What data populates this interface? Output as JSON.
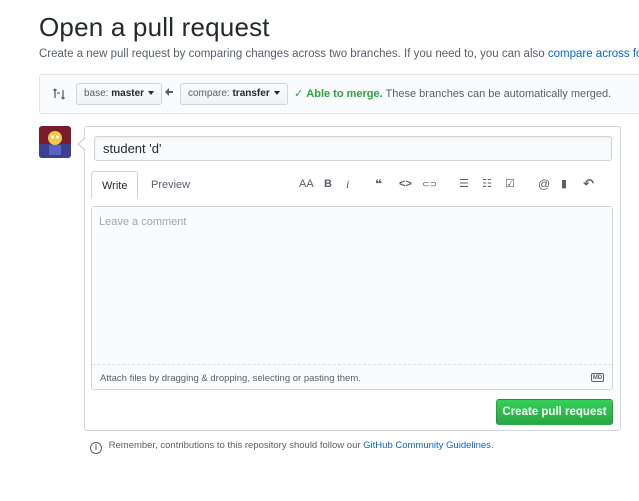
{
  "page": {
    "title": "Open a pull request",
    "subtitle_text": "Create a new pull request by comparing changes across two branches. If you need to, you can also",
    "subtitle_link": "compare across forks",
    "subtitle_end": "."
  },
  "range": {
    "base_prefix": "base:",
    "base_branch": "master",
    "compare_prefix": "compare:",
    "compare_branch": "transfer",
    "merge_status": "Able to merge.",
    "merge_detail": "These branches can be automatically merged."
  },
  "form": {
    "title_value": "student 'd'",
    "tabs": [
      {
        "label": "Write"
      },
      {
        "label": "Preview"
      }
    ],
    "toolbar": {
      "heading": "AA",
      "bold": "B",
      "italic": "i",
      "quote": "❝",
      "code": "<>",
      "link": "⊂⊃",
      "unordered_list": "☰",
      "ordered_list": "☷",
      "task_list": "☑",
      "mention": "@",
      "reference": "▮",
      "reply": "↶"
    },
    "comment_placeholder": "Leave a comment",
    "attach_text": "Attach files by dragging & dropping, selecting or pasting them.",
    "markdown_badge": "MD",
    "submit_label": "Create pull request"
  },
  "footer": {
    "note_text": "Remember, contributions to this repository should follow our",
    "note_link": "GitHub Community Guidelines",
    "note_end": "."
  },
  "colors": {
    "link": "#0366d6",
    "success": "#28a745",
    "border": "#d1d5da"
  }
}
